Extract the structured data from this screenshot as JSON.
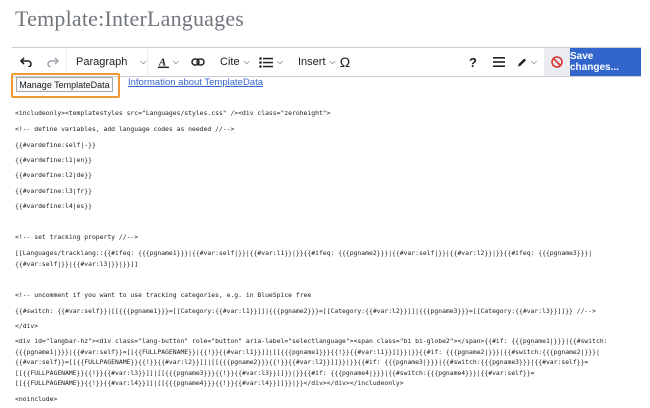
{
  "page": {
    "title": "Template:InterLanguages"
  },
  "toolbar": {
    "undo_icon": "undo-icon",
    "redo_icon": "redo-icon",
    "paragraph_label": "Paragraph",
    "cite_label": "Cite",
    "insert_label": "Insert",
    "save_label": "Save changes...",
    "accent_color": "#3366cc",
    "cancel_color": "#d33"
  },
  "templatedata": {
    "manage_label": "Manage TemplateData",
    "info_link": "Information about TemplateData",
    "highlight_color": "#f29834"
  },
  "code_lines": [
    "<includeonly><templatestyles src=\"Languages/styles.css\" /><div class=\"zeroheight\">",
    "<!-- define variables, add language codes as needed //-->",
    "{{#vardefine:self|-}}",
    "{{#vardefine:l1|en}}",
    "{{#vardefine:l2|de}}",
    "{{#vardefine:l3|fr}}",
    "{{#vardefine:l4|es}}",
    "<!-- set tracking property //-->",
    "[[Languages/tracklang::{{#ifeq: {{{pgname1}}}|{{#var:self|}}|{{#var:l1}}|}}{{#ifeq: {{{pgname2}}}|{{#var:self|}}|{{#var:l2}}|}}{{#ifeq: {{{pgname3}}}|",
    "{{#var:self|}}|{{#var:l3|}}|}}]]",
    "<!-- uncomment if you want to use tracking categories, e.g. in BlueSpice free",
    "{{#switch: {{#var:self}}|[[{{{pgname1}}}=[[Category:{{#var:l1}}]]|{{{pgname2}}}=[[Category:{{#var:l2}}]]|{{{pgname3}}}=[[Category:{{#var:l3}}]]}} //-->",
    "</div>",
    "<div id=\"langbar-hz\"><div class=\"lang-button\" role=\"button\" aria-label=\"selectlanguage\"><span class=\"bi bi-globe2\"></span>{{#if: {{{pgname1|}}}|{{#switch:",
    "{{{pgname1|}}}|{{#var:self}}=[[{{FULLPAGENAME}}|{{!}}{{#var:l1}}]]|[[{{{pgname1}}}{{!}}{{#var:l1}}]]}}|}}{{#if: {{{pgname2|}}}|{{#switch:{{{pgname2|}}}|",
    "{{#var:self}}=[[{{FULLPAGENAME}}{{!}}{{#var:l2}}]]|[[{{{pgname2}}}{{!}}{{#var:l2}}]]}}|}}{{#if: {{{pgname3|}}}|{{#switch:{{{pgname3}}}|{{#var:self}}=",
    "[[{{FULLPAGENAME}}{{!}}{{#var:l3}}]]|[[{{{pgname3}}}{{!}}{{#var:l3}}]]}}|}}{{#if: {{{pgname4|}}}|{{#switch:{{{pgname4}}}|{{#var:self}}=",
    "[[{{FULLPAGENAME}}{{!}}{{#var:l4}}]]|[[{{{pgname4}}}{{!}}{{#var:l4}}]]}}|}}</div></div></includeonly>",
    "<noinclude>"
  ]
}
